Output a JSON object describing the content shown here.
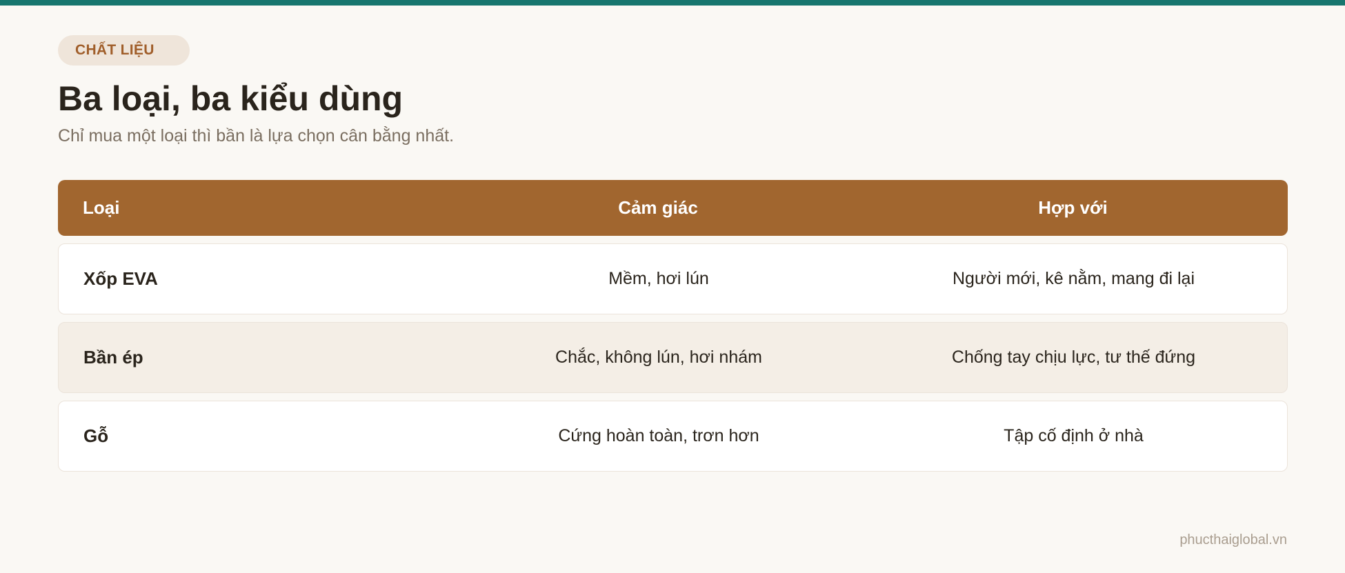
{
  "header": {
    "tag": "CHẤT LIỆU",
    "title": "Ba loại, ba kiểu dùng",
    "subtitle": "Chỉ mua một loại thì bần là lựa chọn cân bằng nhất."
  },
  "table": {
    "columns": [
      "Loại",
      "Cảm giác",
      "Hợp với"
    ],
    "rows": [
      [
        "Xốp EVA",
        "Mềm, hơi lún",
        "Người mới, kê nằm, mang đi lại"
      ],
      [
        "Bần ép",
        "Chắc, không lún, hơi nhám",
        "Chống tay chịu lực, tư thế đứng"
      ],
      [
        "Gỗ",
        "Cứng hoàn toàn, trơn hơn",
        "Tập cố định ở nhà"
      ]
    ]
  },
  "footer": {
    "site": "phucthaiglobal.vn"
  },
  "colors": {
    "accent_bar": "#17766e",
    "header_row": "#a1662f",
    "tag_bg": "#efe5da",
    "tag_text": "#a05e2a",
    "alt_row": "#f4eee6",
    "page_bg": "#faf8f4"
  }
}
